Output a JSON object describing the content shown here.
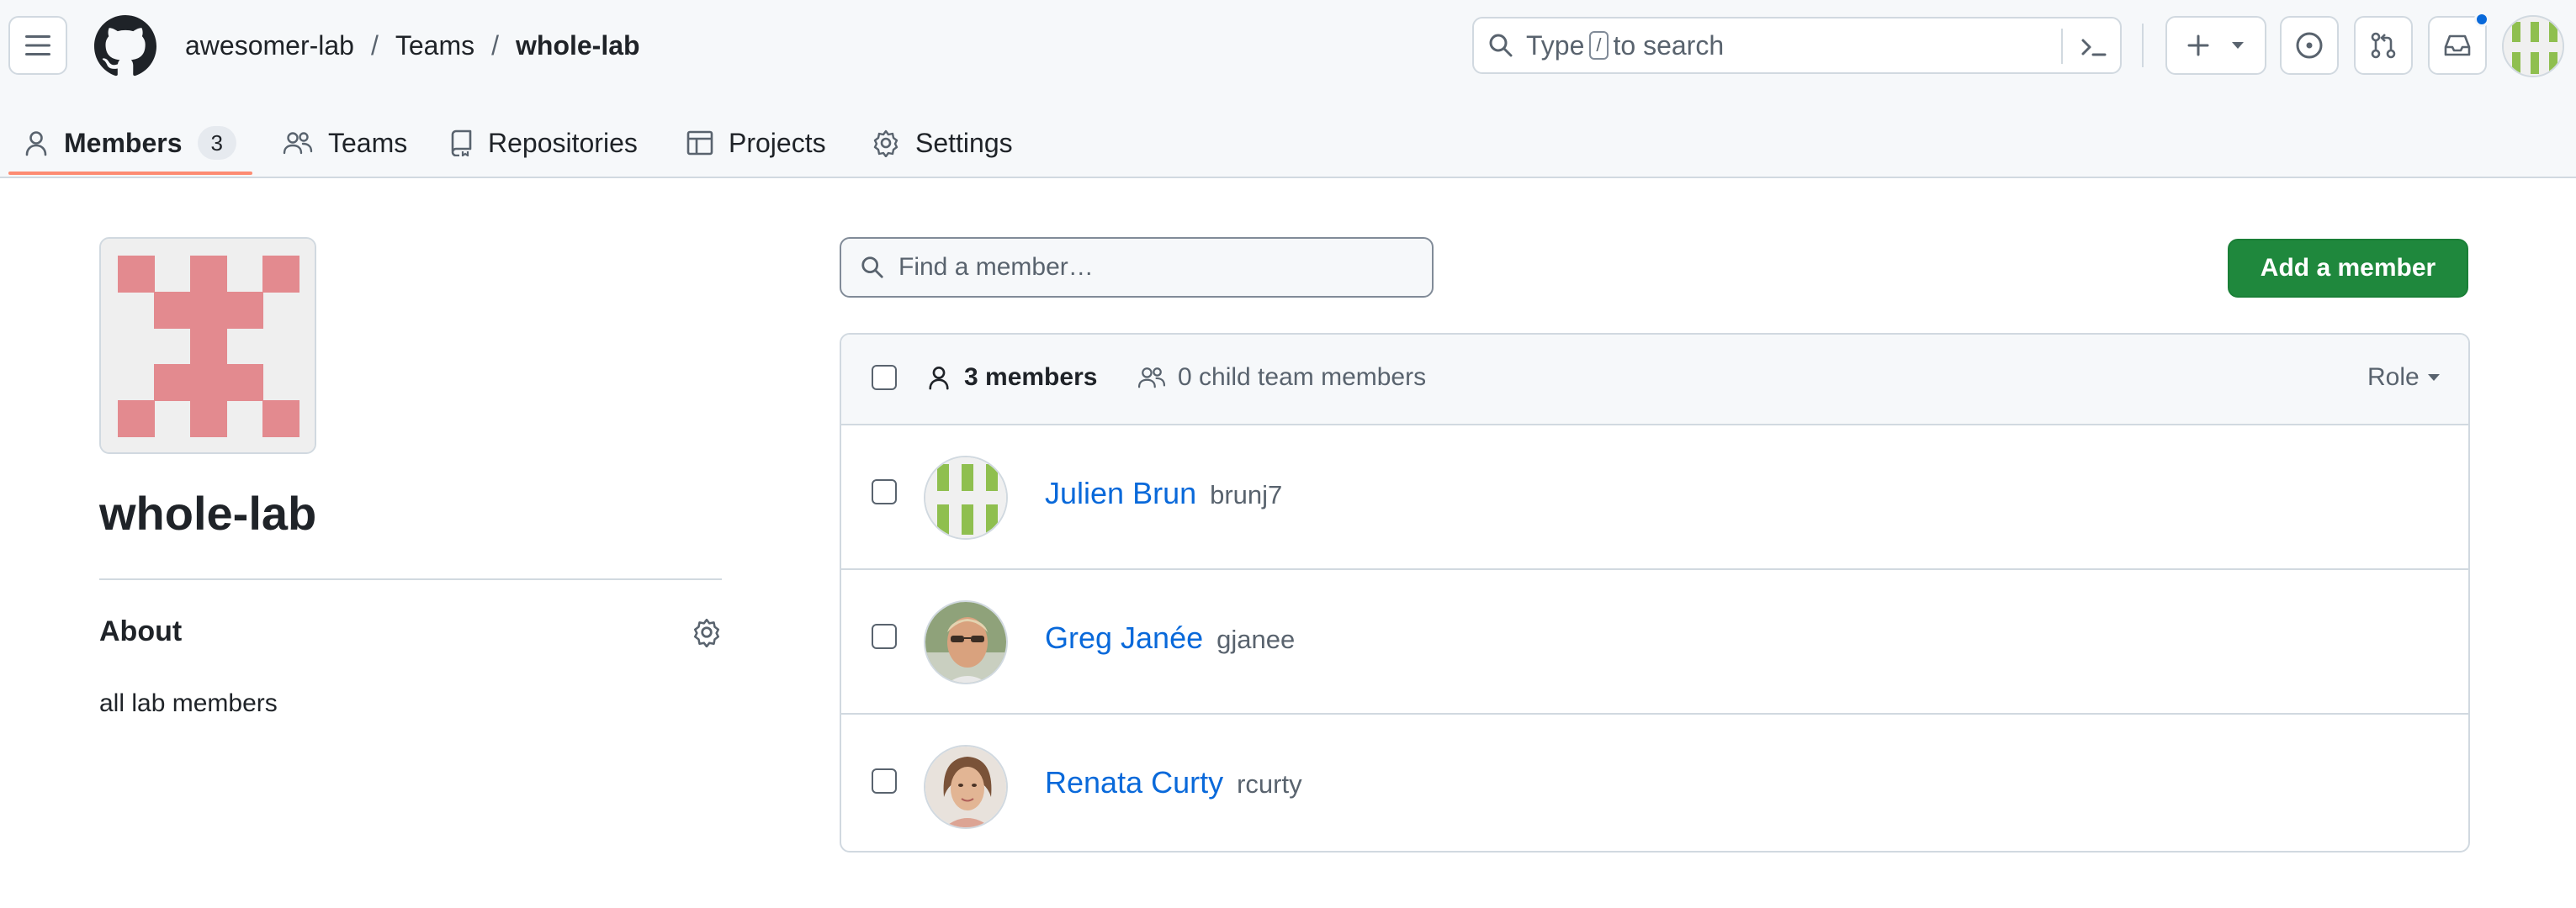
{
  "breadcrumb": {
    "org": "awesomer-lab",
    "section": "Teams",
    "current": "whole-lab",
    "separator": "/"
  },
  "search": {
    "prefix": "Type",
    "key": "/",
    "suffix": "to search"
  },
  "tabs": [
    {
      "label": "Members",
      "counter": "3",
      "icon": "person-icon"
    },
    {
      "label": "Teams",
      "icon": "people-icon"
    },
    {
      "label": "Repositories",
      "icon": "repo-icon"
    },
    {
      "label": "Projects",
      "icon": "table-icon"
    },
    {
      "label": "Settings",
      "icon": "gear-icon"
    }
  ],
  "team": {
    "name": "whole-lab",
    "about_title": "About",
    "description": "all lab members"
  },
  "main": {
    "find_placeholder": "Find a member…",
    "add_button": "Add a member",
    "members_count": "3 members",
    "child_members": "0 child team members",
    "role_label": "Role"
  },
  "members": [
    {
      "name": "Julien Brun",
      "login": "brunj7"
    },
    {
      "name": "Greg Janée",
      "login": "gjanee"
    },
    {
      "name": "Renata Curty",
      "login": "rcurty"
    }
  ],
  "colors": {
    "accent_tab": "#fd8c73",
    "primary_button": "#1f883d",
    "link": "#0969da",
    "team_avatar": "#e38a8f",
    "user_avatar": "#8fbf4f"
  }
}
